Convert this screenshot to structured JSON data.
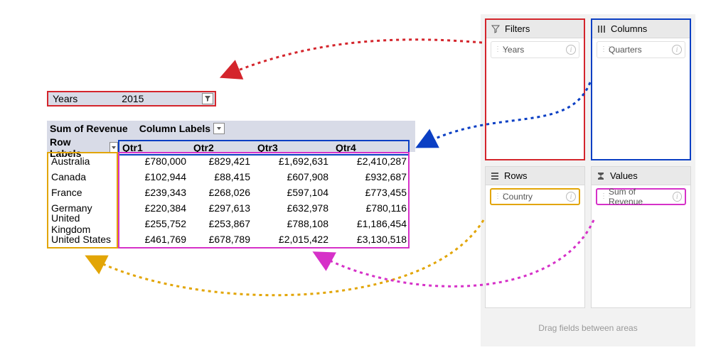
{
  "filter": {
    "label": "Years",
    "value": "2015"
  },
  "pivot": {
    "sum_of_label": "Sum of Revenue",
    "column_labels_label": "Column Labels",
    "row_labels_label": "Row Labels",
    "quarters": [
      "Qtr1",
      "Qtr2",
      "Qtr3",
      "Qtr4"
    ],
    "rows": [
      {
        "country": "Australia",
        "v": [
          "£780,000",
          "£829,421",
          "£1,692,631",
          "£2,410,287"
        ]
      },
      {
        "country": "Canada",
        "v": [
          "£102,944",
          "£88,415",
          "£607,908",
          "£932,687"
        ]
      },
      {
        "country": "France",
        "v": [
          "£239,343",
          "£268,026",
          "£597,104",
          "£773,455"
        ]
      },
      {
        "country": "Germany",
        "v": [
          "£220,384",
          "£297,613",
          "£632,978",
          "£780,116"
        ]
      },
      {
        "country": "United Kingdom",
        "v": [
          "£255,752",
          "£253,867",
          "£788,108",
          "£1,186,454"
        ]
      },
      {
        "country": "United States",
        "v": [
          "£461,769",
          "£678,789",
          "£2,015,422",
          "£3,130,518"
        ]
      }
    ]
  },
  "wells": {
    "filters": {
      "title": "Filters",
      "field": "Years"
    },
    "columns": {
      "title": "Columns",
      "field": "Quarters"
    },
    "rows": {
      "title": "Rows",
      "field": "Country"
    },
    "values": {
      "title": "Values",
      "field": "Sum of Revenue"
    },
    "hint": "Drag fields between areas"
  },
  "colors": {
    "red": "#d4252c",
    "blue": "#0b3fc4",
    "gold": "#e2a506",
    "magenta": "#d631c8"
  }
}
